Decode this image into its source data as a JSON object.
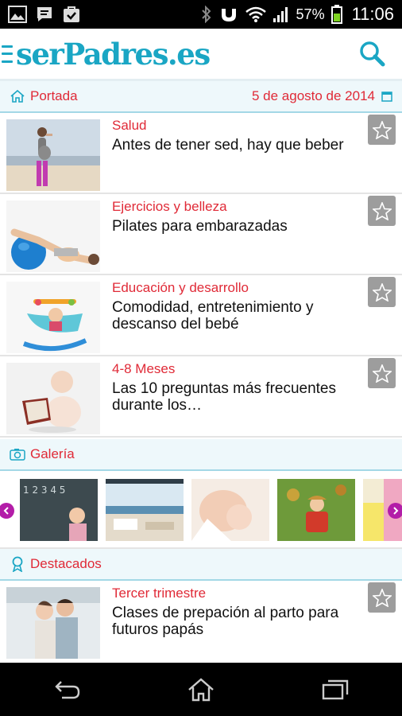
{
  "status_bar": {
    "battery_percent": "57%",
    "time": "11:06",
    "left_icons": [
      "image-icon",
      "chat-icon",
      "check-bag-icon"
    ],
    "right_icons": [
      "bluetooth-icon",
      "vibrate-icon",
      "wifi-icon",
      "signal-icon",
      "battery-icon"
    ]
  },
  "header": {
    "logo_text": "serPadres.es",
    "brand_color": "#1aa6c4",
    "menu_icon": "hamburger-icon",
    "search_icon": "search-icon"
  },
  "portada": {
    "title": "Portada",
    "date": "5 de agosto de 2014",
    "accent_color": "#e02a37"
  },
  "articles": [
    {
      "category": "Salud",
      "title": "Antes de tener sed, hay que beber"
    },
    {
      "category": "Ejercicios y belleza",
      "title": "Pilates para embarazadas"
    },
    {
      "category": "Educación y desarrollo",
      "title": "Comodidad, entretenimiento y descanso del bebé"
    },
    {
      "category": "4-8 Meses",
      "title": "Las 10 preguntas más frecuentes durante los…"
    }
  ],
  "galeria": {
    "title": "Galería",
    "arrow_color": "#b31da8",
    "items": [
      "gallery-chalkboard-girl",
      "gallery-beach-terrace",
      "gallery-breastfeeding",
      "gallery-boy-autumn",
      "gallery-partial"
    ]
  },
  "destacados": {
    "title": "Destacados",
    "articles": [
      {
        "category": "Tercer trimestre",
        "title": "Clases de prepación al parto para futuros papás"
      }
    ]
  },
  "nav_bar": {
    "icons": [
      "back-icon",
      "home-icon",
      "recent-apps-icon"
    ]
  }
}
